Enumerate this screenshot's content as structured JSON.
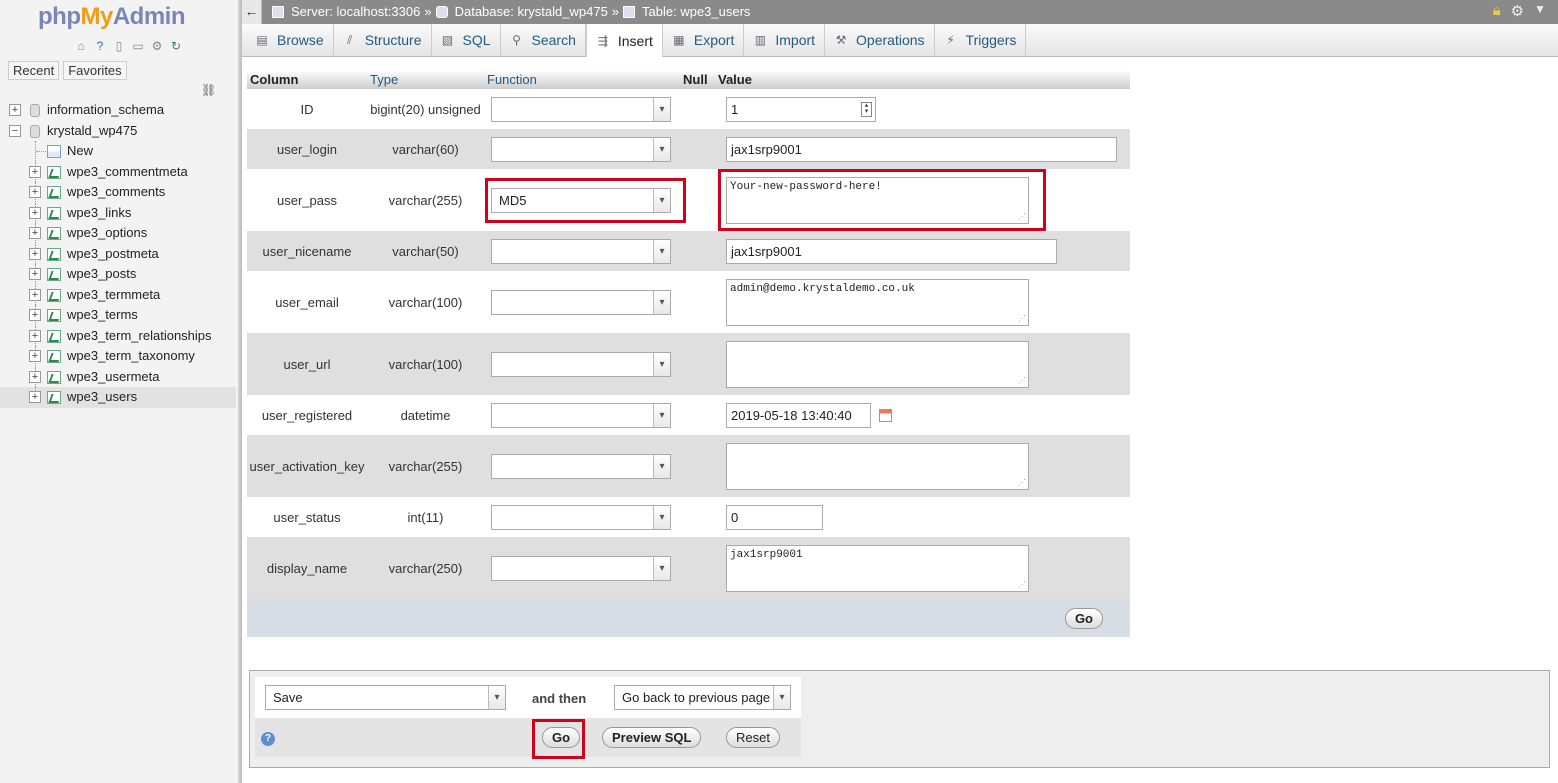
{
  "logo": {
    "php": "php",
    "my": "My",
    "admin": "Admin"
  },
  "sidebar": {
    "recent_label": "Recent",
    "favorites_label": "Favorites",
    "databases": [
      {
        "name": "information_schema"
      },
      {
        "name": "krystald_wp475"
      }
    ],
    "new_label": "New",
    "tables": [
      "wpe3_commentmeta",
      "wpe3_comments",
      "wpe3_links",
      "wpe3_options",
      "wpe3_postmeta",
      "wpe3_posts",
      "wpe3_termmeta",
      "wpe3_terms",
      "wpe3_term_relationships",
      "wpe3_term_taxonomy",
      "wpe3_usermeta",
      "wpe3_users"
    ],
    "selected_table": "wpe3_users"
  },
  "breadcrumb": {
    "server": "Server: localhost:3306",
    "database": "Database: krystald_wp475",
    "table": "Table: wpe3_users",
    "sep": "»"
  },
  "tabs": [
    {
      "label": "Browse",
      "icon": "browse-icon"
    },
    {
      "label": "Structure",
      "icon": "structure-icon"
    },
    {
      "label": "SQL",
      "icon": "sql-icon"
    },
    {
      "label": "Search",
      "icon": "search-icon"
    },
    {
      "label": "Insert",
      "icon": "insert-icon",
      "active": true
    },
    {
      "label": "Export",
      "icon": "export-icon"
    },
    {
      "label": "Import",
      "icon": "import-icon"
    },
    {
      "label": "Operations",
      "icon": "wrench-icon"
    },
    {
      "label": "Triggers",
      "icon": "triggers-icon"
    }
  ],
  "table_headers": {
    "column": "Column",
    "type": "Type",
    "function": "Function",
    "null": "Null",
    "value": "Value"
  },
  "rows": [
    {
      "column": "ID",
      "type": "bigint(20) unsigned",
      "function": "",
      "value": "1",
      "widget": "number"
    },
    {
      "column": "user_login",
      "type": "varchar(60)",
      "function": "",
      "value": "jax1srp9001",
      "widget": "text-long"
    },
    {
      "column": "user_pass",
      "type": "varchar(255)",
      "function": "MD5",
      "value": "Your-new-password-here!",
      "widget": "textarea"
    },
    {
      "column": "user_nicename",
      "type": "varchar(50)",
      "function": "",
      "value": "jax1srp9001",
      "widget": "text-medium"
    },
    {
      "column": "user_email",
      "type": "varchar(100)",
      "function": "",
      "value": "admin@demo.krystaldemo.co.uk",
      "widget": "textarea"
    },
    {
      "column": "user_url",
      "type": "varchar(100)",
      "function": "",
      "value": "",
      "widget": "textarea"
    },
    {
      "column": "user_registered",
      "type": "datetime",
      "function": "",
      "value": "2019-05-18 13:40:40",
      "widget": "datetime"
    },
    {
      "column": "user_activation_key",
      "type": "varchar(255)",
      "function": "",
      "value": "",
      "widget": "textarea"
    },
    {
      "column": "user_status",
      "type": "int(11)",
      "function": "",
      "value": "0",
      "widget": "text-short"
    },
    {
      "column": "display_name",
      "type": "varchar(250)",
      "function": "",
      "value": "jax1srp9001",
      "widget": "textarea"
    }
  ],
  "go_label": "Go",
  "bottom": {
    "action": "Save",
    "and_then": "and then",
    "after": "Go back to previous page",
    "go_label": "Go",
    "preview_label": "Preview SQL",
    "reset_label": "Reset"
  },
  "colors": {
    "highlight": "#d0021b",
    "link": "#235a81"
  }
}
